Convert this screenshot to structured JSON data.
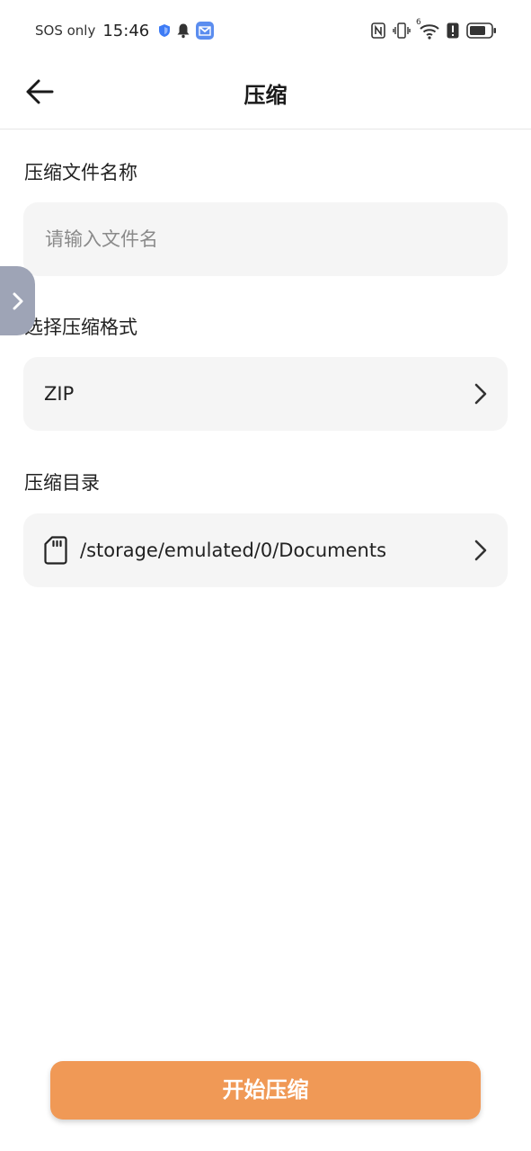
{
  "status_bar": {
    "carrier": "SOS only",
    "time": "15:46",
    "icons_left": [
      "shield-icon",
      "bell-icon",
      "mail-app-icon"
    ],
    "icons_right": [
      "nfc-icon",
      "vibrate-icon",
      "wifi-icon",
      "alert-icon",
      "battery-icon"
    ],
    "wifi_badge": "6"
  },
  "app_bar": {
    "title": "压缩",
    "back_icon": "arrow-left-icon"
  },
  "form": {
    "file_name": {
      "label": "压缩文件名称",
      "value": "",
      "placeholder": "请输入文件名"
    },
    "format": {
      "label": "选择压缩格式",
      "value": "ZIP"
    },
    "directory": {
      "label": "压缩目录",
      "value": "/storage/emulated/0/Documents",
      "icon": "sd-card-icon"
    }
  },
  "side_tab": {
    "icon": "chevron-right-icon"
  },
  "actions": {
    "start_label": "开始压缩"
  },
  "colors": {
    "accent": "#f09956",
    "field_bg": "#f5f5f5",
    "side_tab": "#9ea4b6",
    "shield": "#3d7bf5"
  }
}
